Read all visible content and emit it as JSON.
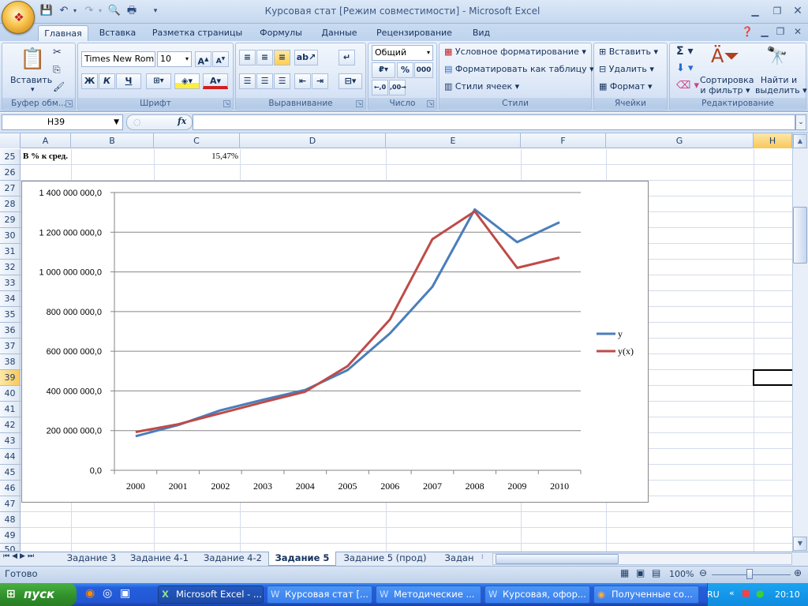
{
  "window": {
    "title": "Курсовая стат  [Режим совместимости] - Microsoft Excel"
  },
  "tabs": [
    "Главная",
    "Вставка",
    "Разметка страницы",
    "Формулы",
    "Данные",
    "Рецензирование",
    "Вид"
  ],
  "ribbon": {
    "clipboard": {
      "label": "Буфер обм...",
      "paste": "Вставить"
    },
    "font": {
      "label": "Шрифт",
      "name": "Times New Rom",
      "size": "10",
      "bold": "Ж",
      "italic": "К",
      "underline": "Ч"
    },
    "alignment": {
      "label": "Выравнивание"
    },
    "number": {
      "label": "Число",
      "format": "Общий",
      "percent": "%",
      "thousands": "000"
    },
    "styles": {
      "label": "Стили",
      "conditional": "Условное форматирование",
      "as_table": "Форматировать как таблицу",
      "cell_styles": "Стили ячеек"
    },
    "cells": {
      "label": "Ячейки",
      "insert": "Вставить",
      "delete": "Удалить",
      "format": "Формат"
    },
    "editing": {
      "label": "Редактирование",
      "sort1": "Сортировка",
      "sort2": "и фильтр",
      "find1": "Найти и",
      "find2": "выделить"
    }
  },
  "formula_bar": {
    "name_box": "H39",
    "fx": "fx",
    "value": ""
  },
  "columns": [
    "A",
    "B",
    "C",
    "D",
    "E",
    "F",
    "G"
  ],
  "rows": [
    "25",
    "26",
    "27",
    "28",
    "29",
    "30",
    "31",
    "32",
    "33",
    "34",
    "35",
    "36",
    "37",
    "38",
    "39",
    "40",
    "41",
    "42",
    "43",
    "44",
    "45",
    "46",
    "47",
    "48",
    "49",
    "50"
  ],
  "cells": {
    "a25": "В % к сред.",
    "c25": "15,47%"
  },
  "chart_data": {
    "type": "line",
    "categories": [
      "2000",
      "2001",
      "2002",
      "2003",
      "2004",
      "2005",
      "2006",
      "2007",
      "2008",
      "2009",
      "2010"
    ],
    "series": [
      {
        "name": "y",
        "color": "#4a7ebb",
        "values": [
          172000000,
          228000000,
          302000000,
          355000000,
          405000000,
          505000000,
          690000000,
          925000000,
          1315000000,
          1150000000,
          1250000000
        ]
      },
      {
        "name": "y(x)",
        "color": "#be4b48",
        "values": [
          193000000,
          232000000,
          287000000,
          343000000,
          396000000,
          525000000,
          760000000,
          1165000000,
          1305000000,
          1020000000,
          1072000000
        ]
      }
    ],
    "yticks": [
      "0,0",
      "200 000 000,0",
      "400 000 000,0",
      "600 000 000,0",
      "800 000 000,0",
      "1 000 000 000,0",
      "1 200 000 000,0",
      "1 400 000 000,0"
    ],
    "ylim": [
      0,
      1400000000
    ],
    "grid": true,
    "legend": "right"
  },
  "sheets": [
    "Задание 3",
    "Задание 4-1",
    "Задание 4-2",
    "Задание 5",
    "Задание 5 (прод)",
    "Задан"
  ],
  "active_sheet": "Задание 5",
  "status": {
    "ready": "Готово",
    "zoom": "100%"
  },
  "taskbar": {
    "start": "пуск",
    "items": [
      "Microsoft Excel - ...",
      "Курсовая стат [...",
      "Методические ...",
      "Курсовая, офор...",
      "Полученные со..."
    ],
    "lang": "RU",
    "clock": "20:10"
  }
}
